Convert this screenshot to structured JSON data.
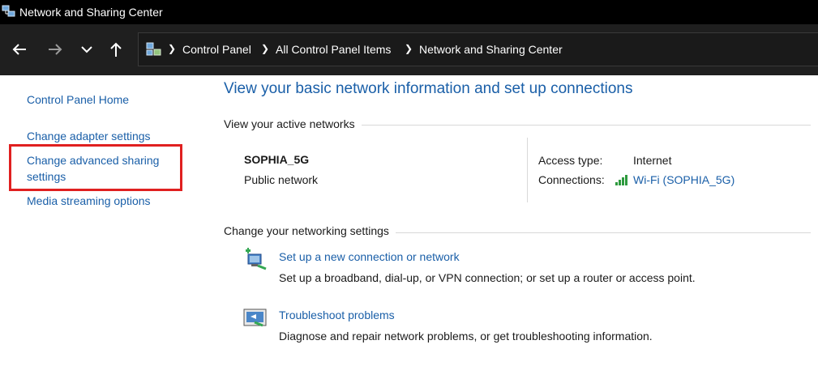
{
  "window": {
    "title": "Network and Sharing Center"
  },
  "breadcrumb": [
    "Control Panel",
    "All Control Panel Items",
    "Network and Sharing Center"
  ],
  "sidebar": {
    "home": "Control Panel Home",
    "items": [
      "Change adapter settings",
      "Change advanced sharing",
      "settings",
      "Media streaming options"
    ]
  },
  "main": {
    "title": "View your basic network information and set up connections",
    "active_networks_header": "View your active networks",
    "network": {
      "name": "SOPHIA_5G",
      "type": "Public network",
      "access_type_label": "Access type:",
      "access_type_value": "Internet",
      "connections_label": "Connections:",
      "connections_value": "Wi-Fi (SOPHIA_5G)"
    },
    "settings_header": "Change your networking settings",
    "tasks": [
      {
        "title": "Set up a new connection or network",
        "desc": "Set up a broadband, dial-up, or VPN connection; or set up a router or access point.",
        "icon": "new-connection-icon"
      },
      {
        "title": "Troubleshoot problems",
        "desc": "Diagnose and repair network problems, or get troubleshooting information.",
        "icon": "troubleshoot-icon"
      }
    ]
  },
  "colors": {
    "link": "#1a5fa8",
    "highlight": "#e02020",
    "titlebar": "#000000",
    "navbar": "#1f1f1f"
  }
}
